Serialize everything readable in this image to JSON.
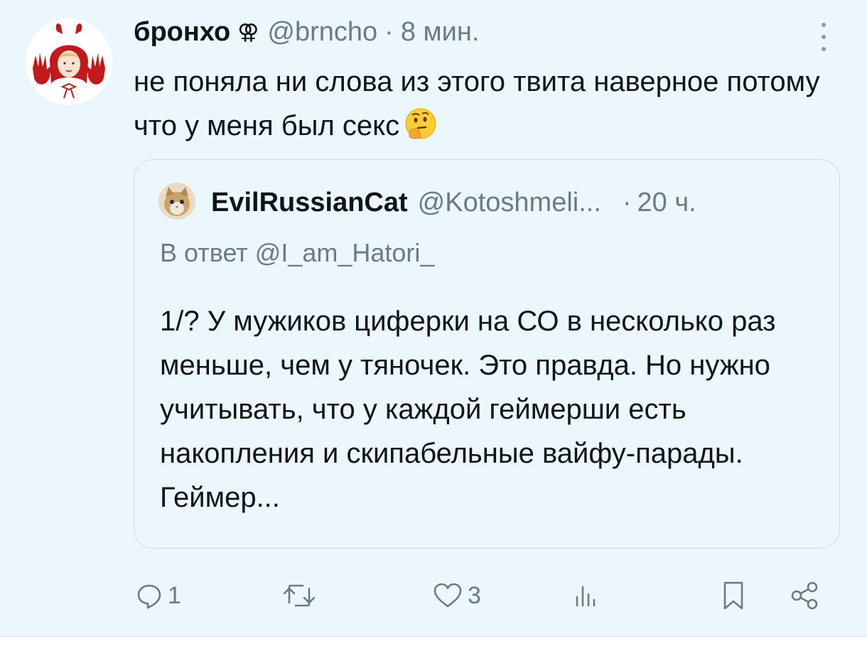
{
  "tweet": {
    "author_name": "бронхо",
    "author_symbol": "⚢",
    "author_handle": "@brncho",
    "separator": "·",
    "time": "8 мин.",
    "text": "не поняла ни слова из этого твита наверное потому что у меня был секс",
    "emoji": "thinking-face"
  },
  "quote": {
    "author_name": "EvilRussianCat",
    "author_handle": "@Kotoshmeli...",
    "separator": "·",
    "time": "20 ч.",
    "reply_to": "В ответ @I_am_Hatori_",
    "text": "1/? У мужиков циферки на СО в несколько раз меньше, чем у тяночек. Это правда. Но нужно учитывать, что у каждой геймерши есть накопления и скипабельные вайфу-парады. Геймер..."
  },
  "actions": {
    "reply_count": "1",
    "retweet_count": "",
    "like_count": "3",
    "views_count": "",
    "icons": [
      "reply-icon",
      "retweet-icon",
      "like-icon",
      "views-icon",
      "bookmark-icon",
      "share-icon"
    ]
  },
  "colors": {
    "background": "#ebf7fd",
    "muted_text": "#6c7a86",
    "primary_text": "#0f1419",
    "border": "#cfd9de",
    "avatar_red": "#c4191b"
  }
}
